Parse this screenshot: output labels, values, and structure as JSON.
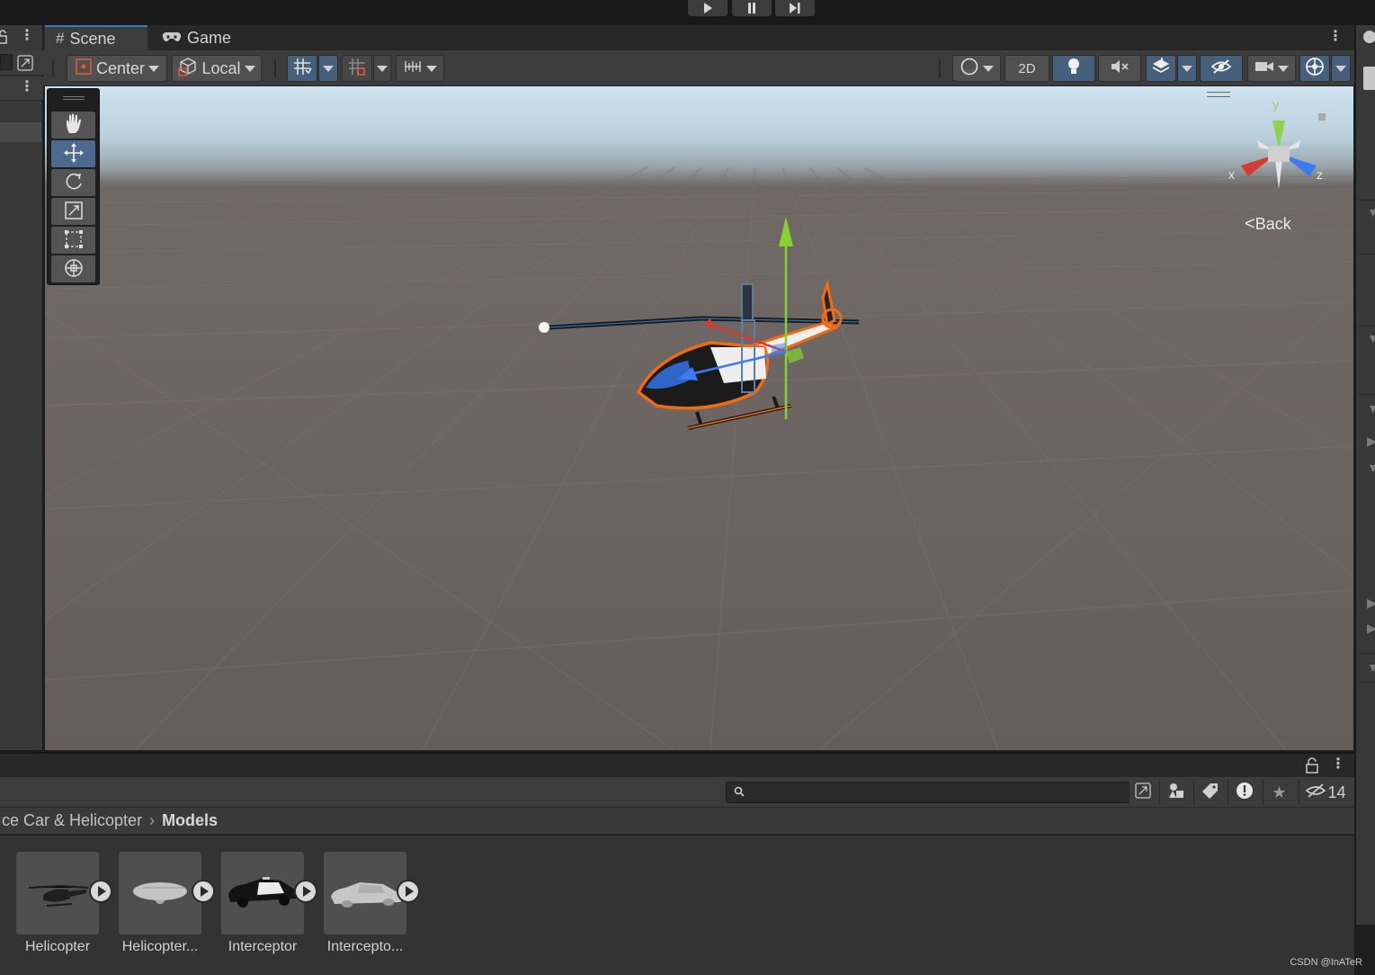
{
  "playbar": {
    "play_icon": "play-icon",
    "pause_icon": "pause-icon",
    "step_icon": "step-icon"
  },
  "tabs": [
    {
      "label": "Scene",
      "icon": "#",
      "active": true
    },
    {
      "label": "Game",
      "icon": "gamepad-icon",
      "active": false
    }
  ],
  "scene_toolbar": {
    "pivot_label": "Center",
    "space_label": "Local",
    "toggle_2d_label": "2D"
  },
  "tools": [
    "hand-tool",
    "move-tool",
    "rotate-tool",
    "scale-tool",
    "rect-tool",
    "transform-tool"
  ],
  "gizmo": {
    "x_label": "x",
    "y_label": "y",
    "z_label": "z",
    "back_label": "Back"
  },
  "project": {
    "search_placeholder": "",
    "hidden_count": "14",
    "breadcrumb": {
      "parent": "ce Car & Helicopter",
      "current": "Models"
    },
    "assets": [
      {
        "name": "Helicopter"
      },
      {
        "name": "Helicopter..."
      },
      {
        "name": "Interceptor"
      },
      {
        "name": "Intercepto..."
      }
    ]
  },
  "colors": {
    "accent": "#3a79bb",
    "selection_outline": "#f26b12",
    "x_axis": "#d63b31",
    "y_axis": "#86d32f",
    "z_axis": "#3b7cf0"
  },
  "watermark": "CSDN @InATeR"
}
